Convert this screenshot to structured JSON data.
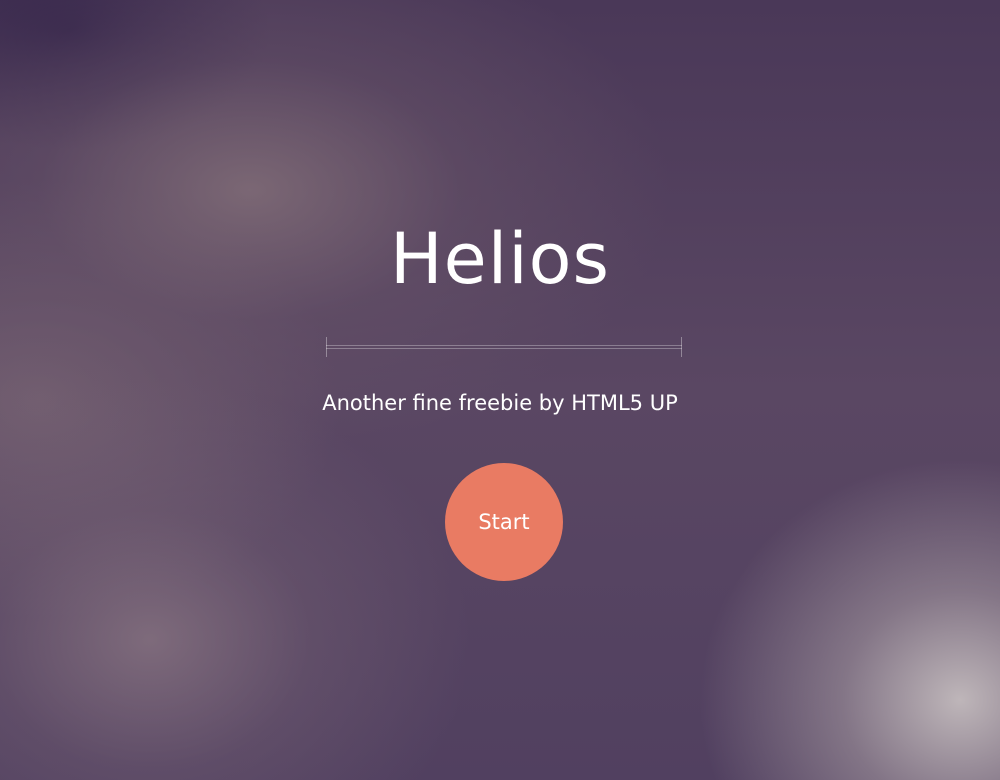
{
  "hero": {
    "title": "Helios",
    "tagline": "Another fine freebie by HTML5 UP",
    "start_label": "Start"
  },
  "colors": {
    "background": "#4f3d5b",
    "accent": "#e97b63",
    "text": "#ffffff"
  }
}
